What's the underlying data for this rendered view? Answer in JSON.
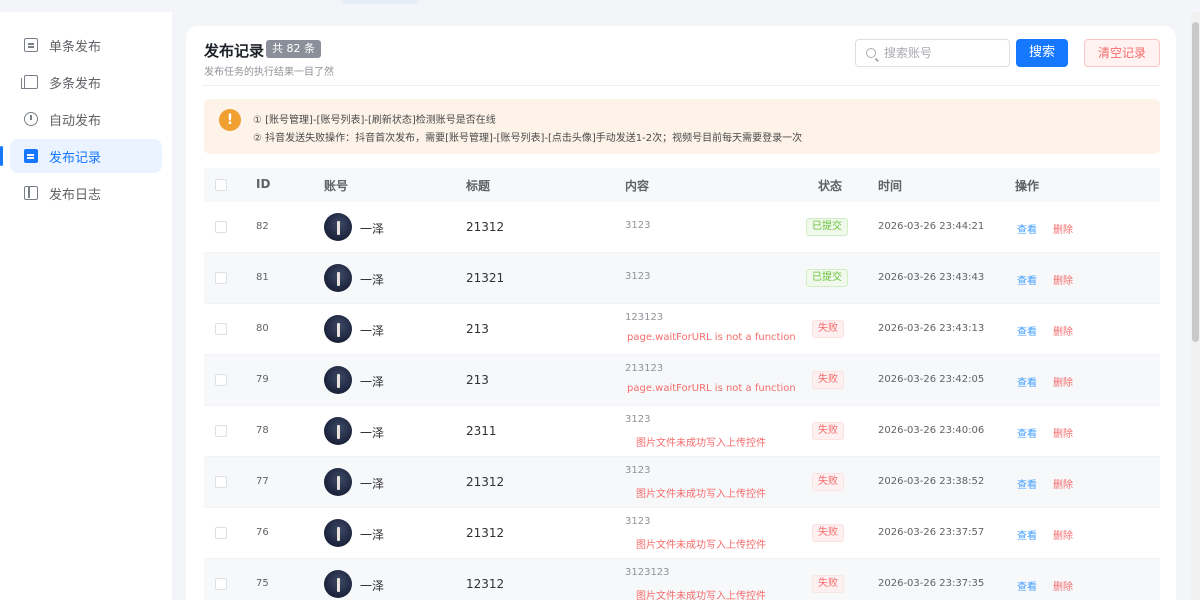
{
  "sidebar": {
    "items": [
      {
        "label": "单条发布",
        "icon": "document-icon",
        "active": false
      },
      {
        "label": "多条发布",
        "icon": "copy-icon",
        "active": false
      },
      {
        "label": "自动发布",
        "icon": "timer-icon",
        "active": false
      },
      {
        "label": "发布记录",
        "icon": "clipboard-icon",
        "active": true
      },
      {
        "label": "发布日志",
        "icon": "book-icon",
        "active": false
      }
    ]
  },
  "header": {
    "title": "发布记录",
    "count": "共 82 条",
    "subtitle": "发布任务的执行结果一目了然",
    "search_placeholder": "搜索账号",
    "search_button": "搜索",
    "clear_button": "清空记录"
  },
  "notice": {
    "icon": "!",
    "line1": "① [账号管理]-[账号列表]-[刷新状态]检测账号是否在线",
    "line2": "② 抖音发送失败操作：抖音首次发布，需要[账号管理]-[账号列表]-[点击头像]手动发送1-2次；视频号目前每天需要登录一次"
  },
  "table": {
    "columns": {
      "id": "ID",
      "account": "账号",
      "title": "标题",
      "content": "内容",
      "status": "状态",
      "time": "时间",
      "actions": "操作"
    },
    "view_label": "查看",
    "delete_label": "删除",
    "rows": [
      {
        "id": "82",
        "account": "一泽",
        "title": "21312",
        "content": "3123",
        "error": "",
        "status": "已提交",
        "status_type": "ok",
        "time": "2026-03-26 23:44:21"
      },
      {
        "id": "81",
        "account": "一泽",
        "title": "21321",
        "content": "3123",
        "error": "",
        "status": "已提交",
        "status_type": "ok",
        "time": "2026-03-26 23:43:43"
      },
      {
        "id": "80",
        "account": "一泽",
        "title": "213",
        "content": "123123",
        "error": "page.waitForURL is not a function",
        "status": "失败",
        "status_type": "fail",
        "time": "2026-03-26 23:43:13"
      },
      {
        "id": "79",
        "account": "一泽",
        "title": "213",
        "content": "213123",
        "error": "page.waitForURL is not a function",
        "status": "失败",
        "status_type": "fail",
        "time": "2026-03-26 23:42:05"
      },
      {
        "id": "78",
        "account": "一泽",
        "title": "2311",
        "content": "3123",
        "error": "图片文件未成功写入上传控件",
        "status": "失败",
        "status_type": "fail",
        "time": "2026-03-26 23:40:06"
      },
      {
        "id": "77",
        "account": "一泽",
        "title": "21312",
        "content": "3123",
        "error": "图片文件未成功写入上传控件",
        "status": "失败",
        "status_type": "fail",
        "time": "2026-03-26 23:38:52"
      },
      {
        "id": "76",
        "account": "一泽",
        "title": "21312",
        "content": "3123",
        "error": "图片文件未成功写入上传控件",
        "status": "失败",
        "status_type": "fail",
        "time": "2026-03-26 23:37:57"
      },
      {
        "id": "75",
        "account": "一泽",
        "title": "12312",
        "content": "3123123",
        "error": "图片文件未成功写入上传控件",
        "status": "失败",
        "status_type": "fail",
        "time": "2026-03-26 23:37:35"
      }
    ]
  },
  "colors": {
    "accent": "#1677ff",
    "success": "#67c23a",
    "danger": "#f56c6c",
    "warning": "#f0a030"
  }
}
